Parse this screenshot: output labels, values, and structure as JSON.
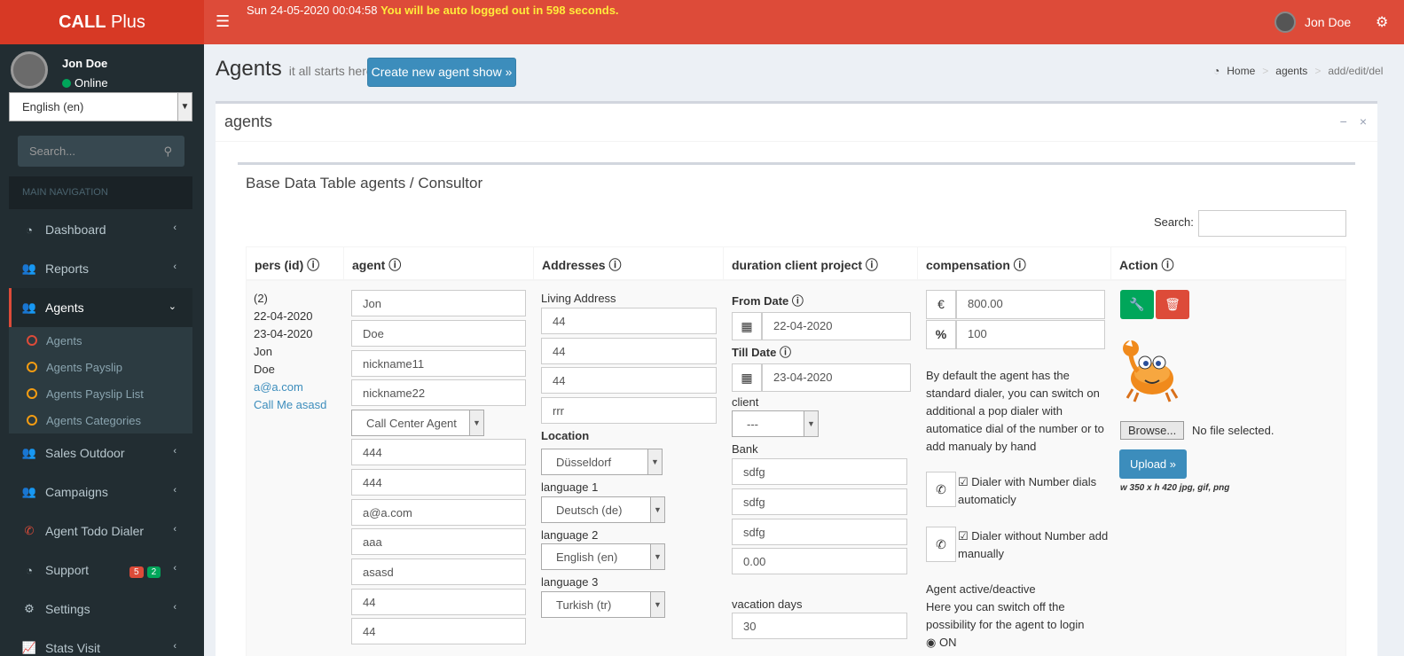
{
  "header": {
    "logo_bold": "CALL",
    "logo_rest": " Plus",
    "datetime": "Sun 24-05-2020 00:04:58",
    "logout_warning": "You will be auto logged out in 598 seconds.",
    "user": "Jon Doe"
  },
  "sidebar": {
    "user_name": "Jon Doe",
    "user_status": "Online",
    "language": "English (en)",
    "search_placeholder": "Search...",
    "nav_header": "MAIN NAVIGATION",
    "items": [
      {
        "label": "Dashboard",
        "icon": "dashboard-icon"
      },
      {
        "label": "Reports",
        "icon": "users-icon"
      },
      {
        "label": "Agents",
        "icon": "users-icon"
      },
      {
        "label": "Sales Outdoor",
        "icon": "users-icon"
      },
      {
        "label": "Campaigns",
        "icon": "users-icon"
      },
      {
        "label": "Agent Todo Dialer",
        "icon": "phone-icon"
      },
      {
        "label": "Support",
        "icon": "dashboard-icon"
      },
      {
        "label": "Settings",
        "icon": "gears-icon"
      },
      {
        "label": "Stats Visit",
        "icon": "chart-icon"
      }
    ],
    "sub_items": [
      "Agents",
      "Agents Payslip",
      "Agents Payslip List",
      "Agents Categories"
    ],
    "support_badges": [
      "5",
      "2"
    ]
  },
  "page": {
    "title": "Agents",
    "subtitle": "it all starts here",
    "create_button": "Create new agent show »",
    "breadcrumb": [
      "Home",
      "agents",
      "add/edit/del"
    ]
  },
  "box": {
    "title": "agents",
    "inner_title": "Base Data Table agents / Consultor",
    "search_label": "Search:"
  },
  "table": {
    "headers": [
      "pers (id)",
      "agent",
      "Addresses",
      "duration client project",
      "compensation",
      "Action"
    ],
    "col1": [
      "(2)",
      "22-04-2020",
      "23-04-2020",
      "Jon",
      "Doe"
    ],
    "col1_links": [
      "a@a.com",
      "Call Me asasd"
    ],
    "agent_fields": [
      "Jon",
      "Doe",
      "nickname11",
      "nickname22"
    ],
    "agent_role": "Call Center Agent",
    "agent_fields2": [
      "444",
      "444",
      "a@a.com",
      "aaa",
      "asasd",
      "44",
      "44"
    ],
    "living_address_label": "Living Address",
    "address_fields": [
      "44",
      "44",
      "44",
      "rrr"
    ],
    "location_label": "Location",
    "location": "Düsseldorf",
    "language1_label": "language 1",
    "language1": "Deutsch (de)",
    "language2_label": "language 2",
    "language2": "English (en)",
    "language3_label": "language 3",
    "language3": "Turkish (tr)",
    "from_date_label": "From Date",
    "from_date": "22-04-2020",
    "till_date_label": "Till Date",
    "till_date": "23-04-2020",
    "client_label": "client",
    "client": "---",
    "bank_label": "Bank",
    "bank_fields": [
      "sdfg",
      "sdfg",
      "sdfg",
      "0.00"
    ],
    "vacation_label": "vacation days",
    "vacation": "30",
    "currency_symbol": "€",
    "amount": "800.00",
    "percent_symbol": "%",
    "percent": "100",
    "dialer_text": "By default the agent has the standard dialer, you can switch on additional a pop dialer with automatice dial of the number or to add manualy by hand",
    "dialer_opt1": "Dialer with Number dials automaticly",
    "dialer_opt2": "Dialer without Number add manually",
    "active_title": "Agent active/deactive",
    "active_text": "Here you can switch off the possibility for the agent to login",
    "active_on": "ON",
    "browse_label": "Browse...",
    "no_file": "No file selected.",
    "upload_label": "Upload »",
    "upload_hint": "w 350 x h 420 jpg, gif, png"
  }
}
